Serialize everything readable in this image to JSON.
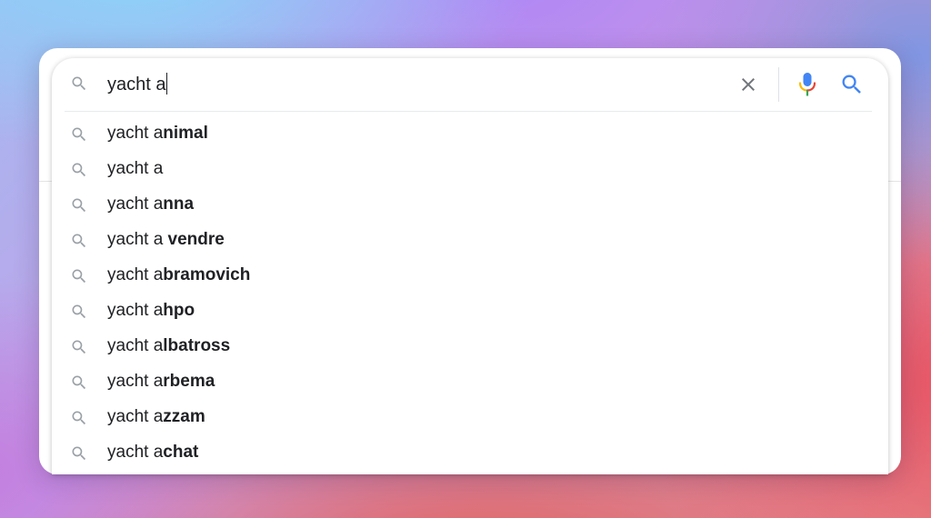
{
  "search": {
    "query": "yacht a",
    "lead_icon": "search-icon",
    "clear_icon": "close-icon",
    "voice_icon": "mic-icon",
    "submit_icon": "search-icon",
    "submit_color": "#4285f4",
    "mic_colors": [
      "#4285f4",
      "#ea4335",
      "#fbbc05",
      "#34a853"
    ]
  },
  "suggestions": [
    {
      "prefix": "yacht a",
      "completion": "nimal"
    },
    {
      "prefix": "yacht a",
      "completion": ""
    },
    {
      "prefix": "yacht a",
      "completion": "nna"
    },
    {
      "prefix": "yacht a ",
      "completion": "vendre"
    },
    {
      "prefix": "yacht a",
      "completion": "bramovich"
    },
    {
      "prefix": "yacht a",
      "completion": "hpo"
    },
    {
      "prefix": "yacht a",
      "completion": "lbatross"
    },
    {
      "prefix": "yacht a",
      "completion": "rbema"
    },
    {
      "prefix": "yacht a",
      "completion": "zzam"
    },
    {
      "prefix": "yacht a",
      "completion": "chat"
    }
  ]
}
